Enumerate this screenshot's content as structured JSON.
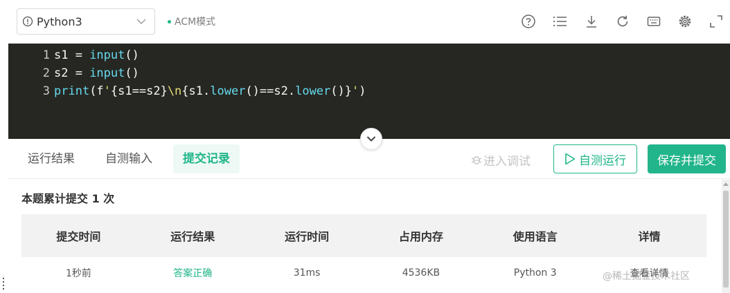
{
  "toolbar": {
    "language": "Python3",
    "mode": "ACM模式",
    "icons": [
      "help-icon",
      "list-icon",
      "download-icon",
      "refresh-icon",
      "keyboard-icon",
      "settings-icon",
      "fullscreen-icon"
    ]
  },
  "editor": {
    "lines": [
      {
        "number": "1",
        "tokens": [
          {
            "text": "s1 = ",
            "kind": "plain"
          },
          {
            "text": "input",
            "kind": "func"
          },
          {
            "text": "()",
            "kind": "plain"
          }
        ]
      },
      {
        "number": "2",
        "tokens": [
          {
            "text": "s2 = ",
            "kind": "plain"
          },
          {
            "text": "input",
            "kind": "func"
          },
          {
            "text": "()",
            "kind": "plain"
          }
        ]
      },
      {
        "number": "3",
        "tokens": [
          {
            "text": "print",
            "kind": "func"
          },
          {
            "text": "(f",
            "kind": "plain"
          },
          {
            "text": "'",
            "kind": "string"
          },
          {
            "text": "{s1==s2}",
            "kind": "plain"
          },
          {
            "text": "\\n",
            "kind": "string"
          },
          {
            "text": "{s1.",
            "kind": "plain"
          },
          {
            "text": "lower",
            "kind": "func"
          },
          {
            "text": "()==s2.",
            "kind": "plain"
          },
          {
            "text": "lower",
            "kind": "func"
          },
          {
            "text": "()}",
            "kind": "plain"
          },
          {
            "text": "'",
            "kind": "string"
          },
          {
            "text": ")",
            "kind": "plain"
          }
        ]
      }
    ]
  },
  "tabs": [
    {
      "label": "运行结果",
      "active": false
    },
    {
      "label": "自测输入",
      "active": false
    },
    {
      "label": "提交记录",
      "active": true
    }
  ],
  "actions": {
    "debug": "进入调试",
    "run": "自测运行",
    "submit": "保存并提交"
  },
  "results": {
    "summary": "本题累计提交 1 次",
    "headers": [
      "提交时间",
      "运行结果",
      "运行时间",
      "占用内存",
      "使用语言",
      "详情"
    ],
    "row": [
      "1秒前",
      "答案正确",
      "31ms",
      "4536KB",
      "Python 3",
      "查看详情"
    ]
  },
  "watermark": "@稀土掘金技术社区",
  "colors": {
    "accent": "#1fb589",
    "editor_bg": "#262722",
    "code_func": "#66d9ef",
    "code_string": "#e6db74"
  }
}
